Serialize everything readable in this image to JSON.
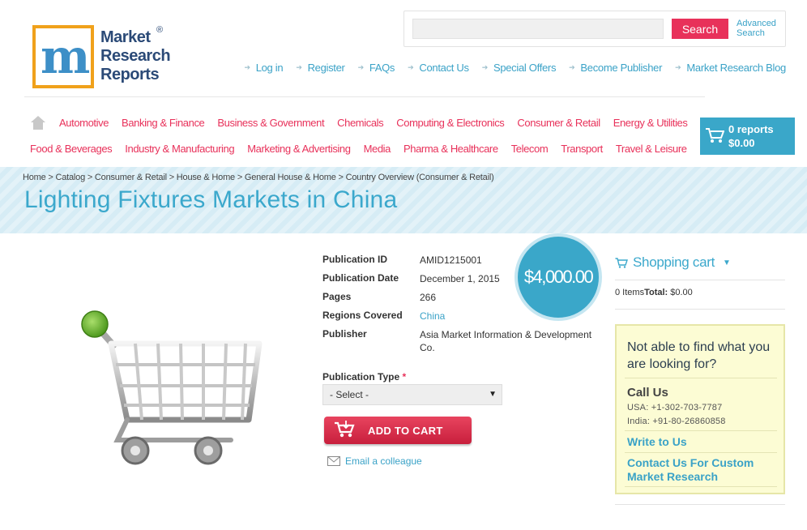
{
  "brand": {
    "logo_lines": [
      "Market",
      "Research",
      "Reports"
    ],
    "registered_mark": "®",
    "accent_orange": "#f0a11b",
    "accent_blue": "#3aa7c9",
    "accent_pink": "#e8315a"
  },
  "search": {
    "placeholder": "",
    "button_label": "Search",
    "advanced_label": "Advanced Search"
  },
  "top_links": [
    "Log in",
    "Register",
    "FAQs",
    "Contact Us",
    "Special Offers",
    "Become Publisher",
    "Market Research Blog"
  ],
  "categories_row1": [
    "Automotive",
    "Banking & Finance",
    "Business & Government",
    "Chemicals",
    "Computing & Electronics",
    "Consumer & Retail",
    "Energy & Utilities"
  ],
  "categories_row2": [
    "Food & Beverages",
    "Industry & Manufacturing",
    "Marketing & Advertising",
    "Media",
    "Pharma & Healthcare",
    "Telecom",
    "Transport",
    "Travel & Leisure"
  ],
  "mini_cart": {
    "reports": "0 reports",
    "total": "$0.00"
  },
  "breadcrumb": "Home > Catalog > Consumer & Retail > House & Home > General House & Home > Country Overview (Consumer & Retail)",
  "page_title": "Lighting Fixtures Markets in China",
  "product": {
    "details": [
      {
        "label": "Publication ID",
        "value": "AMID1215001"
      },
      {
        "label": "Publication Date",
        "value": "December 1, 2015"
      },
      {
        "label": "Pages",
        "value": "266"
      },
      {
        "label": "Regions Covered",
        "value": "China"
      },
      {
        "label": "Publisher",
        "value": "Asia Market Information & Development Co."
      }
    ],
    "price": "$4,000.00",
    "pub_type_label": "Publication Type",
    "required_mark": "*",
    "select_value": "- Select -",
    "add_to_cart": "ADD TO CART",
    "email_colleague": "Email a colleague"
  },
  "shopping_cart": {
    "title": "Shopping cart",
    "items_label": "0 Items",
    "total_label": "Total:",
    "total_value": "$0.00"
  },
  "help": {
    "title": "Not able to find what you are looking for?",
    "call_us": "Call Us",
    "phone_usa": "USA: +1-302-703-7787",
    "phone_india": "India: +91-80-26860858",
    "write_to_us": "Write to Us",
    "custom_research": "Contact Us For Custom Market Research"
  }
}
